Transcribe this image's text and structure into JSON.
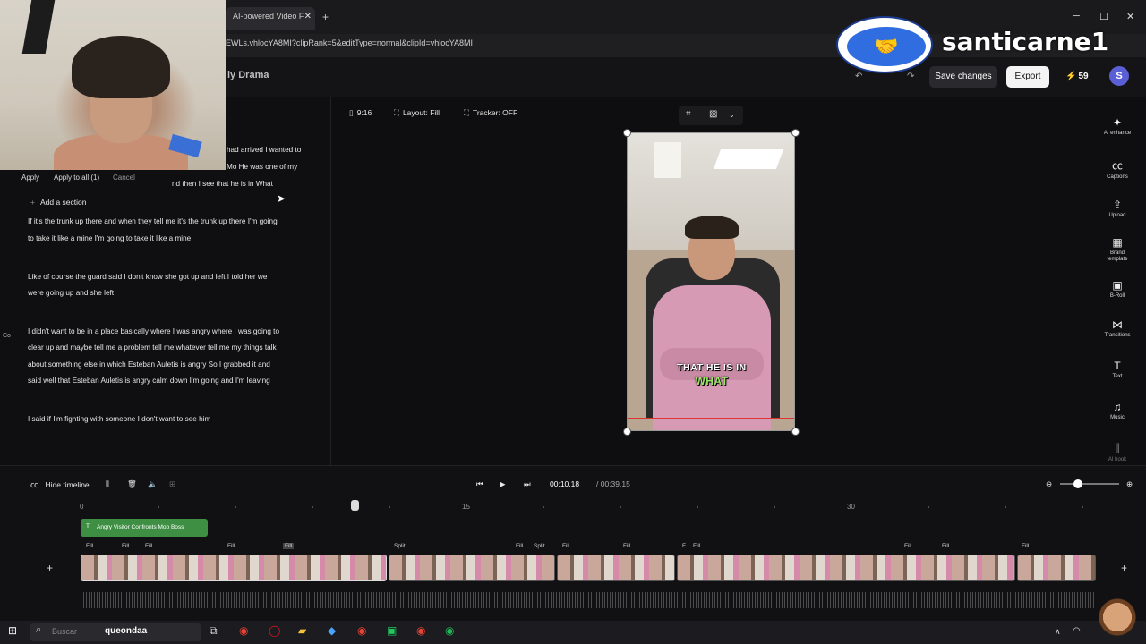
{
  "browser": {
    "tab_title": "AI-powered Video F",
    "tab_close": "✕",
    "new_tab": "+",
    "url": "EWLs.vhlocYA8MI?clipRank=5&editType=normal&clipId=vhlocYA8MI",
    "window_controls": [
      "─",
      "☐",
      "✕"
    ]
  },
  "header": {
    "project_title": "ly Drama",
    "save_label": "Save changes",
    "export_label": "Export",
    "credits": "59",
    "avatar_initial": "S"
  },
  "overlay": {
    "brand_name": "santicarne1"
  },
  "transcript": {
    "toolbar": {
      "apply": "Apply",
      "apply_all": "Apply to all (1)",
      "cancel": "Cancel"
    },
    "add_section": "Add a section",
    "top_lines": [
      "had arrived I wanted to",
      "Mo He was one of my",
      "nd then I see that he is in What"
    ],
    "paragraphs": [
      [
        "If it's the trunk up there and when they tell me it's the trunk up there I'm going",
        "to take it like a mine I'm going to take it like a mine"
      ],
      [
        "Like of course the guard said I don't know she got up and left I told her we",
        "were going up and she left"
      ],
      [
        "I didn't want to be in a place basically where I was angry where I was going to",
        "clear up and maybe tell me a problem tell me whatever tell me my things talk",
        "about something else in which Esteban Auletis is angry So I grabbed it and",
        "said well that Esteban Auletis is angry calm down I'm going and I'm leaving"
      ],
      [
        "I said if I'm fighting with someone I don't want to see him"
      ]
    ]
  },
  "preview": {
    "aspect": "9:16",
    "layout": "Layout: Fill",
    "tracker": "Tracker: OFF",
    "caption_line1": "THAT HE IS IN",
    "caption_line2": "WHAT"
  },
  "right_tools": [
    {
      "icon": "✦",
      "label": "AI enhance"
    },
    {
      "icon": "㏄",
      "label": "Captions"
    },
    {
      "icon": "⇪",
      "label": "Upload"
    },
    {
      "icon": "▦",
      "label": "Brand template"
    },
    {
      "icon": "▣",
      "label": "B-Roll"
    },
    {
      "icon": "⋈",
      "label": "Transitions"
    },
    {
      "icon": "T",
      "label": "Text"
    },
    {
      "icon": "♫",
      "label": "Music"
    },
    {
      "icon": "⫼",
      "label": "AI hook"
    }
  ],
  "timeline": {
    "hide_label": "Hide timeline",
    "current_time": "00:10.18",
    "total_time": "/ 00:39.15",
    "ruler": [
      "0",
      "15",
      "30"
    ],
    "section_name": "Angry Visitor Confronts Mob Boss",
    "clip_labels": [
      "Fill",
      "Fill",
      "Fill",
      "Fill",
      "Fill",
      "Split",
      "Fill",
      "Split",
      "Fill",
      "Fill",
      "F",
      "Fill",
      "Fill",
      "Fill",
      "Fill",
      "Fill"
    ],
    "add": "+"
  },
  "taskbar": {
    "search_placeholder": "Buscar",
    "search_query": "queondaa"
  },
  "edge_texts": [
    "Co",
    "St"
  ]
}
